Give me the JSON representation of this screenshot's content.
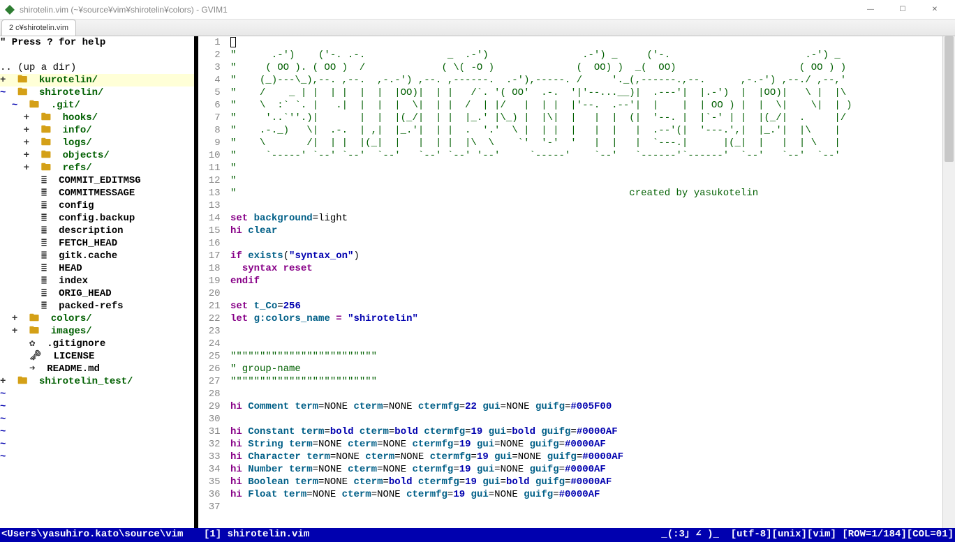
{
  "window": {
    "title": "shirotelin.vim (~¥source¥vim¥shirotelin¥colors) - GVIM1"
  },
  "tab": {
    "label": "2 c¥shirotelin.vim"
  },
  "sidebar": {
    "help": "\" Press ? for help",
    "updir": ".. (up a dir)",
    "path": "</yasuhiro.kato/source/vim/",
    "items": [
      {
        "depth": 0,
        "sign": "+",
        "icon": "folder",
        "label": "kurotelin/",
        "type": "dir"
      },
      {
        "depth": 0,
        "sign": "~",
        "icon": "folder",
        "label": "shirotelin/",
        "type": "dir"
      },
      {
        "depth": 1,
        "sign": "~",
        "icon": "folder",
        "label": ".git/",
        "type": "dir"
      },
      {
        "depth": 2,
        "sign": "+",
        "icon": "folder",
        "label": "hooks/",
        "type": "dir"
      },
      {
        "depth": 2,
        "sign": "+",
        "icon": "folder",
        "label": "info/",
        "type": "dir"
      },
      {
        "depth": 2,
        "sign": "+",
        "icon": "folder",
        "label": "logs/",
        "type": "dir"
      },
      {
        "depth": 2,
        "sign": "+",
        "icon": "folder",
        "label": "objects/",
        "type": "dir"
      },
      {
        "depth": 2,
        "sign": "+",
        "icon": "folder",
        "label": "refs/",
        "type": "dir"
      },
      {
        "depth": 2,
        "sign": " ",
        "icon": "file",
        "label": "COMMIT_EDITMSG",
        "type": "file"
      },
      {
        "depth": 2,
        "sign": " ",
        "icon": "file",
        "label": "COMMITMESSAGE",
        "type": "file"
      },
      {
        "depth": 2,
        "sign": " ",
        "icon": "file",
        "label": "config",
        "type": "file"
      },
      {
        "depth": 2,
        "sign": " ",
        "icon": "file",
        "label": "config.backup",
        "type": "file"
      },
      {
        "depth": 2,
        "sign": " ",
        "icon": "file",
        "label": "description",
        "type": "file"
      },
      {
        "depth": 2,
        "sign": " ",
        "icon": "file",
        "label": "FETCH_HEAD",
        "type": "file"
      },
      {
        "depth": 2,
        "sign": " ",
        "icon": "file",
        "label": "gitk.cache",
        "type": "file"
      },
      {
        "depth": 2,
        "sign": " ",
        "icon": "file",
        "label": "HEAD",
        "type": "file"
      },
      {
        "depth": 2,
        "sign": " ",
        "icon": "file",
        "label": "index",
        "type": "file"
      },
      {
        "depth": 2,
        "sign": " ",
        "icon": "file",
        "label": "ORIG_HEAD",
        "type": "file"
      },
      {
        "depth": 2,
        "sign": " ",
        "icon": "file",
        "label": "packed-refs",
        "type": "file"
      },
      {
        "depth": 1,
        "sign": "+",
        "icon": "folder",
        "label": "colors/",
        "type": "dir"
      },
      {
        "depth": 1,
        "sign": "+",
        "icon": "folder",
        "label": "images/",
        "type": "dir"
      },
      {
        "depth": 1,
        "sign": " ",
        "icon": "gear",
        "label": ".gitignore",
        "type": "file"
      },
      {
        "depth": 1,
        "sign": " ",
        "icon": "key",
        "label": "LICENSE",
        "type": "file"
      },
      {
        "depth": 1,
        "sign": " ",
        "icon": "down",
        "label": "README.md",
        "type": "file"
      },
      {
        "depth": 0,
        "sign": "+",
        "icon": "folder",
        "label": "shirotelin_test/",
        "type": "dir"
      }
    ]
  },
  "ascii_art": [
    "\"      .-')    ('-. .-.              _  .-')                .-') _     ('-.                       .-') _  ",
    "\"     ( OO ). ( OO )  /             ( \\( -O )              (  OO) )  _(  OO)                     ( OO ) ) ",
    "\"    (_)---\\_),--. ,--.  ,-.-') ,--. ,------.  .-'),-----. /     '._(,------.,--.      ,-.-') ,--./ ,--,'  ",
    "\"    /    _ | |  | |  |  |  |OO)|  | |   /`. '( OO'  .-.  '|'--...__)|  .---'|  |.-')  |  |OO)|   \\ |  |\\  ",
    "\"    \\  :` `. |   .|  |  |  |  \\|  | |  /  | |/   |  | |  |'--.  .--'|  |    |  | OO ) |  |  \\|    \\|  | ) ",
    "\"     '..`''.)|       |  |  |(_/|  | |  |_.' |\\_) |  |\\|  |   |  |  (|  '--. |  |`-' | |  |(_/|  .     |/  ",
    "\"    .-._)   \\|  .-.  | ,|  |_.'|  | |  .  '.'  \\ |  | |  |   |  |   |  .--'(|  '---.',|  |_.'|  |\\    |   ",
    "\"    \\       /|  | |  |(_|  |   |  | |  |\\  \\    `'  '-'  '   |  |   |  `---.|      |(_|  |   |  | \\   |   ",
    "\"     `-----' `--' `--'  `--'   `--' `--' '--'     `-----'    `--'   `------'`------'  `--'   `--'  `--'   ",
    "\"",
    "\"",
    "\"                                                                   created by yasukotelin"
  ],
  "code_lines": [
    {
      "num": 13,
      "spans": []
    },
    {
      "num": 14,
      "spans": [
        {
          "cls": "keyword",
          "t": "set"
        },
        {
          "cls": "",
          "t": " "
        },
        {
          "cls": "ident",
          "t": "background"
        },
        {
          "cls": "",
          "t": "=light"
        }
      ]
    },
    {
      "num": 15,
      "spans": [
        {
          "cls": "keyword",
          "t": "hi"
        },
        {
          "cls": "",
          "t": " "
        },
        {
          "cls": "ident",
          "t": "clear"
        }
      ]
    },
    {
      "num": 16,
      "spans": []
    },
    {
      "num": 17,
      "spans": [
        {
          "cls": "keyword",
          "t": "if"
        },
        {
          "cls": "",
          "t": " "
        },
        {
          "cls": "func",
          "t": "exists"
        },
        {
          "cls": "",
          "t": "("
        },
        {
          "cls": "string",
          "t": "\"syntax_on\""
        },
        {
          "cls": "",
          "t": ")"
        }
      ]
    },
    {
      "num": 18,
      "spans": [
        {
          "cls": "",
          "t": "  "
        },
        {
          "cls": "keyword",
          "t": "syntax reset"
        }
      ]
    },
    {
      "num": 19,
      "spans": [
        {
          "cls": "keyword",
          "t": "endif"
        }
      ]
    },
    {
      "num": 20,
      "spans": []
    },
    {
      "num": 21,
      "spans": [
        {
          "cls": "keyword",
          "t": "set"
        },
        {
          "cls": "",
          "t": " "
        },
        {
          "cls": "ident",
          "t": "t_Co"
        },
        {
          "cls": "",
          "t": "="
        },
        {
          "cls": "number",
          "t": "256"
        }
      ]
    },
    {
      "num": 22,
      "spans": [
        {
          "cls": "keyword",
          "t": "let"
        },
        {
          "cls": "",
          "t": " "
        },
        {
          "cls": "ident",
          "t": "g:colors_name"
        },
        {
          "cls": "",
          "t": " "
        },
        {
          "cls": "keyword",
          "t": "="
        },
        {
          "cls": "",
          "t": " "
        },
        {
          "cls": "string",
          "t": "\"shirotelin\""
        }
      ]
    },
    {
      "num": 23,
      "spans": []
    },
    {
      "num": 24,
      "spans": []
    },
    {
      "num": 25,
      "spans": [
        {
          "cls": "comment",
          "t": "\"\"\"\"\"\"\"\"\"\"\"\"\"\"\"\"\"\"\"\"\"\"\"\"\""
        }
      ]
    },
    {
      "num": 26,
      "spans": [
        {
          "cls": "comment",
          "t": "\" group-name"
        }
      ]
    },
    {
      "num": 27,
      "spans": [
        {
          "cls": "comment",
          "t": "\"\"\"\"\"\"\"\"\"\"\"\"\"\"\"\"\"\"\"\"\"\"\"\"\""
        }
      ]
    },
    {
      "num": 28,
      "spans": []
    },
    {
      "num": 29,
      "spans": [
        {
          "cls": "keyword",
          "t": "hi"
        },
        {
          "cls": "",
          "t": " "
        },
        {
          "cls": "type",
          "t": "Comment"
        },
        {
          "cls": "",
          "t": " "
        },
        {
          "cls": "hi-attr",
          "t": "term"
        },
        {
          "cls": "",
          "t": "=NONE "
        },
        {
          "cls": "hi-attr",
          "t": "cterm"
        },
        {
          "cls": "",
          "t": "=NONE "
        },
        {
          "cls": "hi-attr",
          "t": "ctermfg"
        },
        {
          "cls": "",
          "t": "="
        },
        {
          "cls": "number",
          "t": "22"
        },
        {
          "cls": "",
          "t": " "
        },
        {
          "cls": "hi-attr",
          "t": "gui"
        },
        {
          "cls": "",
          "t": "=NONE "
        },
        {
          "cls": "hi-attr",
          "t": "guifg"
        },
        {
          "cls": "",
          "t": "="
        },
        {
          "cls": "number",
          "t": "#005F00"
        }
      ]
    },
    {
      "num": 30,
      "spans": []
    },
    {
      "num": 31,
      "spans": [
        {
          "cls": "keyword",
          "t": "hi"
        },
        {
          "cls": "",
          "t": " "
        },
        {
          "cls": "type",
          "t": "Constant"
        },
        {
          "cls": "",
          "t": " "
        },
        {
          "cls": "hi-attr",
          "t": "term"
        },
        {
          "cls": "",
          "t": "="
        },
        {
          "cls": "number",
          "t": "bold"
        },
        {
          "cls": "",
          "t": " "
        },
        {
          "cls": "hi-attr",
          "t": "cterm"
        },
        {
          "cls": "",
          "t": "="
        },
        {
          "cls": "number",
          "t": "bold"
        },
        {
          "cls": "",
          "t": " "
        },
        {
          "cls": "hi-attr",
          "t": "ctermfg"
        },
        {
          "cls": "",
          "t": "="
        },
        {
          "cls": "number",
          "t": "19"
        },
        {
          "cls": "",
          "t": " "
        },
        {
          "cls": "hi-attr",
          "t": "gui"
        },
        {
          "cls": "",
          "t": "="
        },
        {
          "cls": "number",
          "t": "bold"
        },
        {
          "cls": "",
          "t": " "
        },
        {
          "cls": "hi-attr",
          "t": "guifg"
        },
        {
          "cls": "",
          "t": "="
        },
        {
          "cls": "number",
          "t": "#0000AF"
        }
      ]
    },
    {
      "num": 32,
      "spans": [
        {
          "cls": "keyword",
          "t": "hi"
        },
        {
          "cls": "",
          "t": " "
        },
        {
          "cls": "type",
          "t": "String"
        },
        {
          "cls": "",
          "t": " "
        },
        {
          "cls": "hi-attr",
          "t": "term"
        },
        {
          "cls": "",
          "t": "=NONE "
        },
        {
          "cls": "hi-attr",
          "t": "cterm"
        },
        {
          "cls": "",
          "t": "=NONE "
        },
        {
          "cls": "hi-attr",
          "t": "ctermfg"
        },
        {
          "cls": "",
          "t": "="
        },
        {
          "cls": "number",
          "t": "19"
        },
        {
          "cls": "",
          "t": " "
        },
        {
          "cls": "hi-attr",
          "t": "gui"
        },
        {
          "cls": "",
          "t": "=NONE "
        },
        {
          "cls": "hi-attr",
          "t": "guifg"
        },
        {
          "cls": "",
          "t": "="
        },
        {
          "cls": "number",
          "t": "#0000AF"
        }
      ]
    },
    {
      "num": 33,
      "spans": [
        {
          "cls": "keyword",
          "t": "hi"
        },
        {
          "cls": "",
          "t": " "
        },
        {
          "cls": "type",
          "t": "Character"
        },
        {
          "cls": "",
          "t": " "
        },
        {
          "cls": "hi-attr",
          "t": "term"
        },
        {
          "cls": "",
          "t": "=NONE "
        },
        {
          "cls": "hi-attr",
          "t": "cterm"
        },
        {
          "cls": "",
          "t": "=NONE "
        },
        {
          "cls": "hi-attr",
          "t": "ctermfg"
        },
        {
          "cls": "",
          "t": "="
        },
        {
          "cls": "number",
          "t": "19"
        },
        {
          "cls": "",
          "t": " "
        },
        {
          "cls": "hi-attr",
          "t": "gui"
        },
        {
          "cls": "",
          "t": "=NONE "
        },
        {
          "cls": "hi-attr",
          "t": "guifg"
        },
        {
          "cls": "",
          "t": "="
        },
        {
          "cls": "number",
          "t": "#0000AF"
        }
      ]
    },
    {
      "num": 34,
      "spans": [
        {
          "cls": "keyword",
          "t": "hi"
        },
        {
          "cls": "",
          "t": " "
        },
        {
          "cls": "type",
          "t": "Number"
        },
        {
          "cls": "",
          "t": " "
        },
        {
          "cls": "hi-attr",
          "t": "term"
        },
        {
          "cls": "",
          "t": "=NONE "
        },
        {
          "cls": "hi-attr",
          "t": "cterm"
        },
        {
          "cls": "",
          "t": "=NONE "
        },
        {
          "cls": "hi-attr",
          "t": "ctermfg"
        },
        {
          "cls": "",
          "t": "="
        },
        {
          "cls": "number",
          "t": "19"
        },
        {
          "cls": "",
          "t": " "
        },
        {
          "cls": "hi-attr",
          "t": "gui"
        },
        {
          "cls": "",
          "t": "=NONE "
        },
        {
          "cls": "hi-attr",
          "t": "guifg"
        },
        {
          "cls": "",
          "t": "="
        },
        {
          "cls": "number",
          "t": "#0000AF"
        }
      ]
    },
    {
      "num": 35,
      "spans": [
        {
          "cls": "keyword",
          "t": "hi"
        },
        {
          "cls": "",
          "t": " "
        },
        {
          "cls": "type",
          "t": "Boolean"
        },
        {
          "cls": "",
          "t": " "
        },
        {
          "cls": "hi-attr",
          "t": "term"
        },
        {
          "cls": "",
          "t": "=NONE "
        },
        {
          "cls": "hi-attr",
          "t": "cterm"
        },
        {
          "cls": "",
          "t": "="
        },
        {
          "cls": "number",
          "t": "bold"
        },
        {
          "cls": "",
          "t": " "
        },
        {
          "cls": "hi-attr",
          "t": "ctermfg"
        },
        {
          "cls": "",
          "t": "="
        },
        {
          "cls": "number",
          "t": "19"
        },
        {
          "cls": "",
          "t": " "
        },
        {
          "cls": "hi-attr",
          "t": "gui"
        },
        {
          "cls": "",
          "t": "="
        },
        {
          "cls": "number",
          "t": "bold"
        },
        {
          "cls": "",
          "t": " "
        },
        {
          "cls": "hi-attr",
          "t": "guifg"
        },
        {
          "cls": "",
          "t": "="
        },
        {
          "cls": "number",
          "t": "#0000AF"
        }
      ]
    },
    {
      "num": 36,
      "spans": [
        {
          "cls": "keyword",
          "t": "hi"
        },
        {
          "cls": "",
          "t": " "
        },
        {
          "cls": "type",
          "t": "Float"
        },
        {
          "cls": "",
          "t": " "
        },
        {
          "cls": "hi-attr",
          "t": "term"
        },
        {
          "cls": "",
          "t": "=NONE "
        },
        {
          "cls": "hi-attr",
          "t": "cterm"
        },
        {
          "cls": "",
          "t": "=NONE "
        },
        {
          "cls": "hi-attr",
          "t": "ctermfg"
        },
        {
          "cls": "",
          "t": "="
        },
        {
          "cls": "number",
          "t": "19"
        },
        {
          "cls": "",
          "t": " "
        },
        {
          "cls": "hi-attr",
          "t": "gui"
        },
        {
          "cls": "",
          "t": "=NONE "
        },
        {
          "cls": "hi-attr",
          "t": "guifg"
        },
        {
          "cls": "",
          "t": "="
        },
        {
          "cls": "number",
          "t": "#0000AF"
        }
      ]
    },
    {
      "num": 37,
      "spans": []
    }
  ],
  "status": {
    "left": "<Users\\yasuhiro.kato\\source\\vim",
    "right_file": "[1] shirotelin.vim",
    "right_info": "_(:3｣ ∠ )_  [utf-8][unix][vim] [ROW=1/184][COL=01]"
  }
}
